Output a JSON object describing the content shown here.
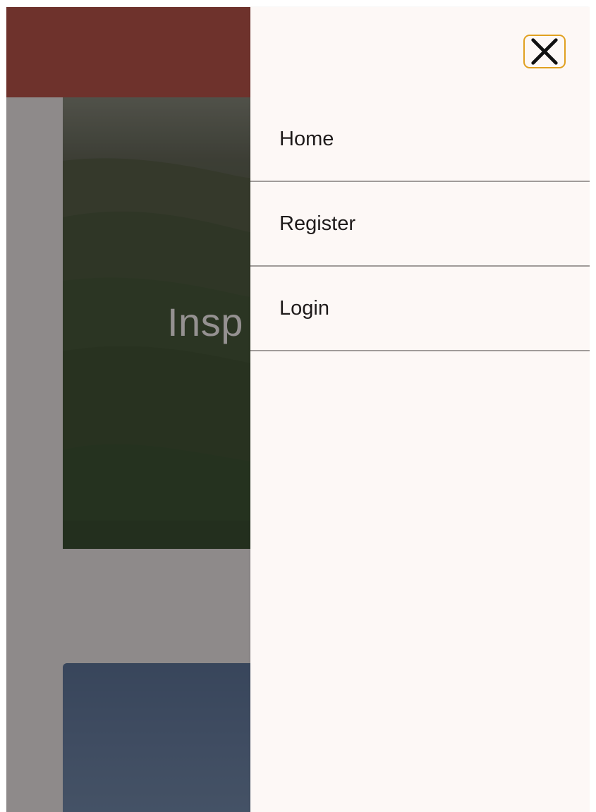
{
  "background_page": {
    "hero_title": "Insp"
  },
  "drawer": {
    "close_icon": "close-x-icon",
    "items": [
      {
        "label": "Home"
      },
      {
        "label": "Register"
      },
      {
        "label": "Login"
      }
    ]
  },
  "colors": {
    "appbar": "#b54a3e",
    "drawer_bg": "#fdf8f6",
    "focus_ring": "#e0a020",
    "divider": "#a09b99"
  }
}
